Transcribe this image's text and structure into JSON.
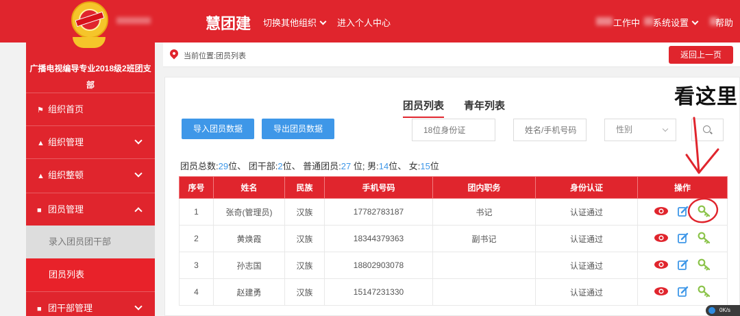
{
  "header": {
    "app_title": "慧团建",
    "switch_org": "切换其他组织",
    "personal_center": "进入个人中心",
    "workbench": "工作中",
    "settings": "系统设置",
    "help": "帮助"
  },
  "sidebar": {
    "org_name_line1": "广播电视编导专业2018级2班团支",
    "org_name_line2": "部",
    "items": [
      {
        "label": "组织首页",
        "icon": "home-icon"
      },
      {
        "label": "组织管理",
        "icon": "org-tree-icon"
      },
      {
        "label": "组织整顿",
        "icon": "org-tree-icon"
      },
      {
        "label": "团员管理",
        "icon": "members-icon"
      },
      {
        "label": "团干部管理",
        "icon": "members-icon"
      }
    ],
    "sub_items": [
      "录入团员团干部",
      "团员列表"
    ]
  },
  "breadcrumb": {
    "text": "当前位置:团员列表",
    "back_label": "返回上一页"
  },
  "tabs": [
    "团员列表",
    "青年列表"
  ],
  "toolbar": {
    "import_label": "导入团员数据",
    "export_label": "导出团员数据",
    "id_placeholder": "18位身份证",
    "name_placeholder": "姓名/手机号码",
    "gender_placeholder": "性别"
  },
  "summary": {
    "p1": "团员总数:",
    "total": "29",
    "p2": "位、 团干部:",
    "cadres": "2",
    "p3": "位、 普通团员:",
    "regular": "27",
    "p4": " 位; 男:",
    "male": "14",
    "p5": "位、 女:",
    "female": "15",
    "p6": "位"
  },
  "table": {
    "headers": [
      "序号",
      "姓名",
      "民族",
      "手机号码",
      "团内职务",
      "身份认证",
      "操作"
    ],
    "rows": [
      [
        "1",
        "张奇(管理员)",
        "汉族",
        "17782783187",
        "书记",
        "认证通过"
      ],
      [
        "2",
        "黄焕霞",
        "汉族",
        "18344379363",
        "副书记",
        "认证通过"
      ],
      [
        "3",
        "孙志国",
        "汉族",
        "18802903078",
        "",
        "认证通过"
      ],
      [
        "4",
        "赵建勇",
        "汉族",
        "15147231330",
        "",
        "认证通过"
      ]
    ]
  },
  "annotation": {
    "text": "看这里",
    "color": "#e0252d"
  },
  "net_speed": "0K/s",
  "colors": {
    "brand_red": "#e0252d",
    "button_blue": "#3e97e8"
  }
}
